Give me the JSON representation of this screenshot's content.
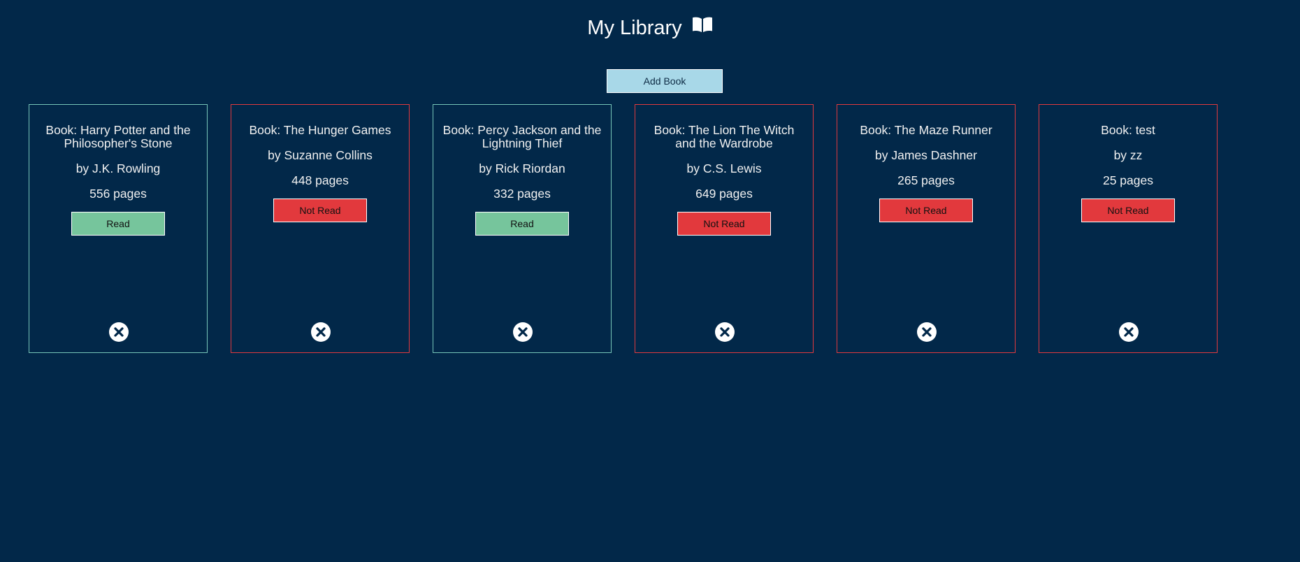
{
  "header": {
    "title": "My Library",
    "icon": "open-book-icon"
  },
  "toolbar": {
    "add_label": "Add Book"
  },
  "colors": {
    "background": "#022849",
    "read_border": "#76c5b8",
    "unread_border": "#e0393e",
    "read_button": "#76c59c",
    "unread_button": "#e2393d",
    "add_button": "#a8d8e8"
  },
  "books": [
    {
      "title": "Book: Harry Potter and the Philosopher's Stone",
      "author": "by J.K. Rowling",
      "pages": "556 pages",
      "status": "Read",
      "read": true
    },
    {
      "title": "Book: The Hunger Games",
      "author": "by Suzanne Collins",
      "pages": "448 pages",
      "status": "Not Read",
      "read": false
    },
    {
      "title": "Book: Percy Jackson and the Lightning Thief",
      "author": "by Rick Riordan",
      "pages": "332 pages",
      "status": "Read",
      "read": true
    },
    {
      "title": "Book: The Lion The Witch and the Wardrobe",
      "author": "by C.S. Lewis",
      "pages": "649 pages",
      "status": "Not Read",
      "read": false
    },
    {
      "title": "Book: The Maze Runner",
      "author": "by James Dashner",
      "pages": "265 pages",
      "status": "Not Read",
      "read": false
    },
    {
      "title": "Book: test",
      "author": "by zz",
      "pages": "25 pages",
      "status": "Not Read",
      "read": false
    }
  ]
}
